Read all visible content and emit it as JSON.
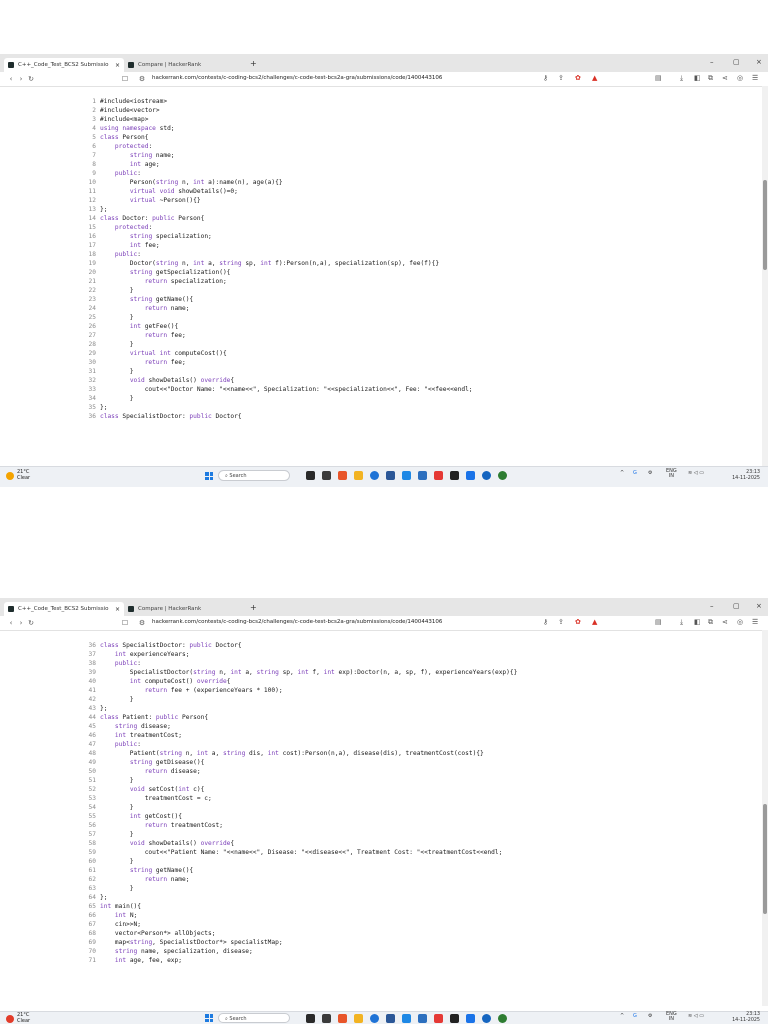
{
  "browser": {
    "tabs": [
      {
        "title": "C++_Code_Test_BCS2 Submissio",
        "active": true,
        "close": "×"
      },
      {
        "title": "Compare | HackerRank",
        "active": false
      }
    ],
    "new_tab": "+",
    "window_controls": {
      "minimize": "–",
      "maximize": "▢",
      "close": "×"
    },
    "url": "hackerrank.com/contests/c-coding-bcs2/challenges/c-code-test-bcs2a-gra/submissions/code/1400443106"
  },
  "screenshots": [
    {
      "first_line": 1,
      "lines": [
        "#include<iostream>",
        "#include<vector>",
        "#include<map>",
        "using namespace std;",
        "class Person{",
        "    protected:",
        "        string name;",
        "        int age;",
        "    public:",
        "        Person(string n, int a):name(n), age(a){}",
        "        virtual void showDetails()=0;",
        "        virtual ~Person(){}",
        "};",
        "class Doctor: public Person{",
        "    protected:",
        "        string specialization;",
        "        int fee;",
        "    public:",
        "        Doctor(string n, int a, string sp, int f):Person(n,a), specialization(sp), fee(f){}",
        "        string getSpecialization(){",
        "            return specialization;",
        "        }",
        "        string getName(){",
        "            return name;",
        "        }",
        "        int getFee(){",
        "            return fee;",
        "        }",
        "        virtual int computeCost(){",
        "            return fee;",
        "        }",
        "        void showDetails() override{",
        "            cout<<\"Doctor Name: \"<<name<<\", Specialization: \"<<specialization<<\", Fee: \"<<fee<<endl;",
        "        }",
        "};",
        "class SpecialistDoctor: public Doctor{"
      ],
      "taskbar": {
        "temp": "21°C",
        "cond": "Clear",
        "search": "Search",
        "lang1": "ENG",
        "lang2": "IN",
        "time": "23:13",
        "date": "14-11-2025"
      }
    },
    {
      "first_line": 36,
      "lines": [
        "class SpecialistDoctor: public Doctor{",
        "    int experienceYears;",
        "    public:",
        "        SpecialistDoctor(string n, int a, string sp, int f, int exp):Doctor(n, a, sp, f), experienceYears(exp){}",
        "        int computeCost() override{",
        "            return fee + (experienceYears * 100);",
        "        }",
        "};",
        "class Patient: public Person{",
        "    string disease;",
        "    int treatmentCost;",
        "    public:",
        "        Patient(string n, int a, string dis, int cost):Person(n,a), disease(dis), treatmentCost(cost){}",
        "        string getDisease(){",
        "            return disease;",
        "        }",
        "        void setCost(int c){",
        "            treatmentCost = c;",
        "        }",
        "        int getCost(){",
        "            return treatmentCost;",
        "        }",
        "        void showDetails() override{",
        "            cout<<\"Patient Name: \"<<name<<\", Disease: \"<<disease<<\", Treatment Cost: \"<<treatmentCost<<endl;",
        "        }",
        "        string getName(){",
        "            return name;",
        "        }",
        "};",
        "int main(){",
        "    int N;",
        "    cin>>N;",
        "    vector<Person*> allObjects;",
        "    map<string, SpecialistDoctor*> specialistMap;",
        "    string name, specialization, disease;",
        "    int age, fee, exp;"
      ],
      "taskbar": {
        "temp": "21°C",
        "cond": "Clear",
        "search": "Search",
        "lang1": "ENG",
        "lang2": "IN",
        "time": "23:13",
        "date": "14-11-2025"
      }
    }
  ],
  "colors": {
    "keyword": "#7a3db8",
    "type": "#1e3fa6",
    "line_number": "#8a8a8a"
  }
}
